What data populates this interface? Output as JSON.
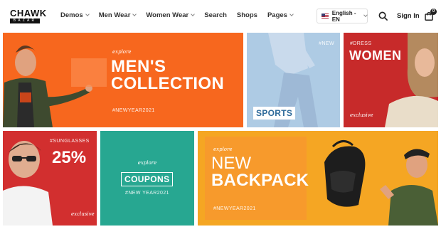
{
  "header": {
    "logo": {
      "main": "CHAWK",
      "sub": "BAZAR"
    },
    "nav": [
      {
        "label": "Demos",
        "dropdown": true
      },
      {
        "label": "Men Wear",
        "dropdown": true
      },
      {
        "label": "Women Wear",
        "dropdown": true
      },
      {
        "label": "Search",
        "dropdown": false
      },
      {
        "label": "Shops",
        "dropdown": false
      },
      {
        "label": "Pages",
        "dropdown": true
      }
    ],
    "language": "English - EN",
    "signin": "Sign In",
    "cart_count": "0",
    "icons": {
      "search": "search-icon",
      "cart": "shopping-bag-icon",
      "flag": "us-flag-icon"
    }
  },
  "banners": {
    "men": {
      "script": "explore",
      "line1": "MEN'S",
      "line2": "COLLECTION",
      "tag": "#NEWYEAR2021"
    },
    "sports": {
      "tag": "#NEW",
      "label": "SPORTS"
    },
    "women": {
      "tag": "#DRESS",
      "title": "WOMEN",
      "script": "exclusive"
    },
    "sunglasses": {
      "tag": "#SUNGLASSES",
      "title": "25%",
      "script": "exclusive"
    },
    "coupons": {
      "script": "explore",
      "label": "COUPONS",
      "tag": "#NEW YEAR2021"
    },
    "backpack": {
      "script": "explore",
      "line1": "NEW",
      "line2": "BACKPACK",
      "tag": "#NEWYEAR2021"
    }
  },
  "colors": {
    "men": "#f7671e",
    "sports": "#aecbe4",
    "women": "#c72a2a",
    "sunglasses": "#d22f2f",
    "coupons": "#27a791",
    "backpack": "#f5a623"
  }
}
